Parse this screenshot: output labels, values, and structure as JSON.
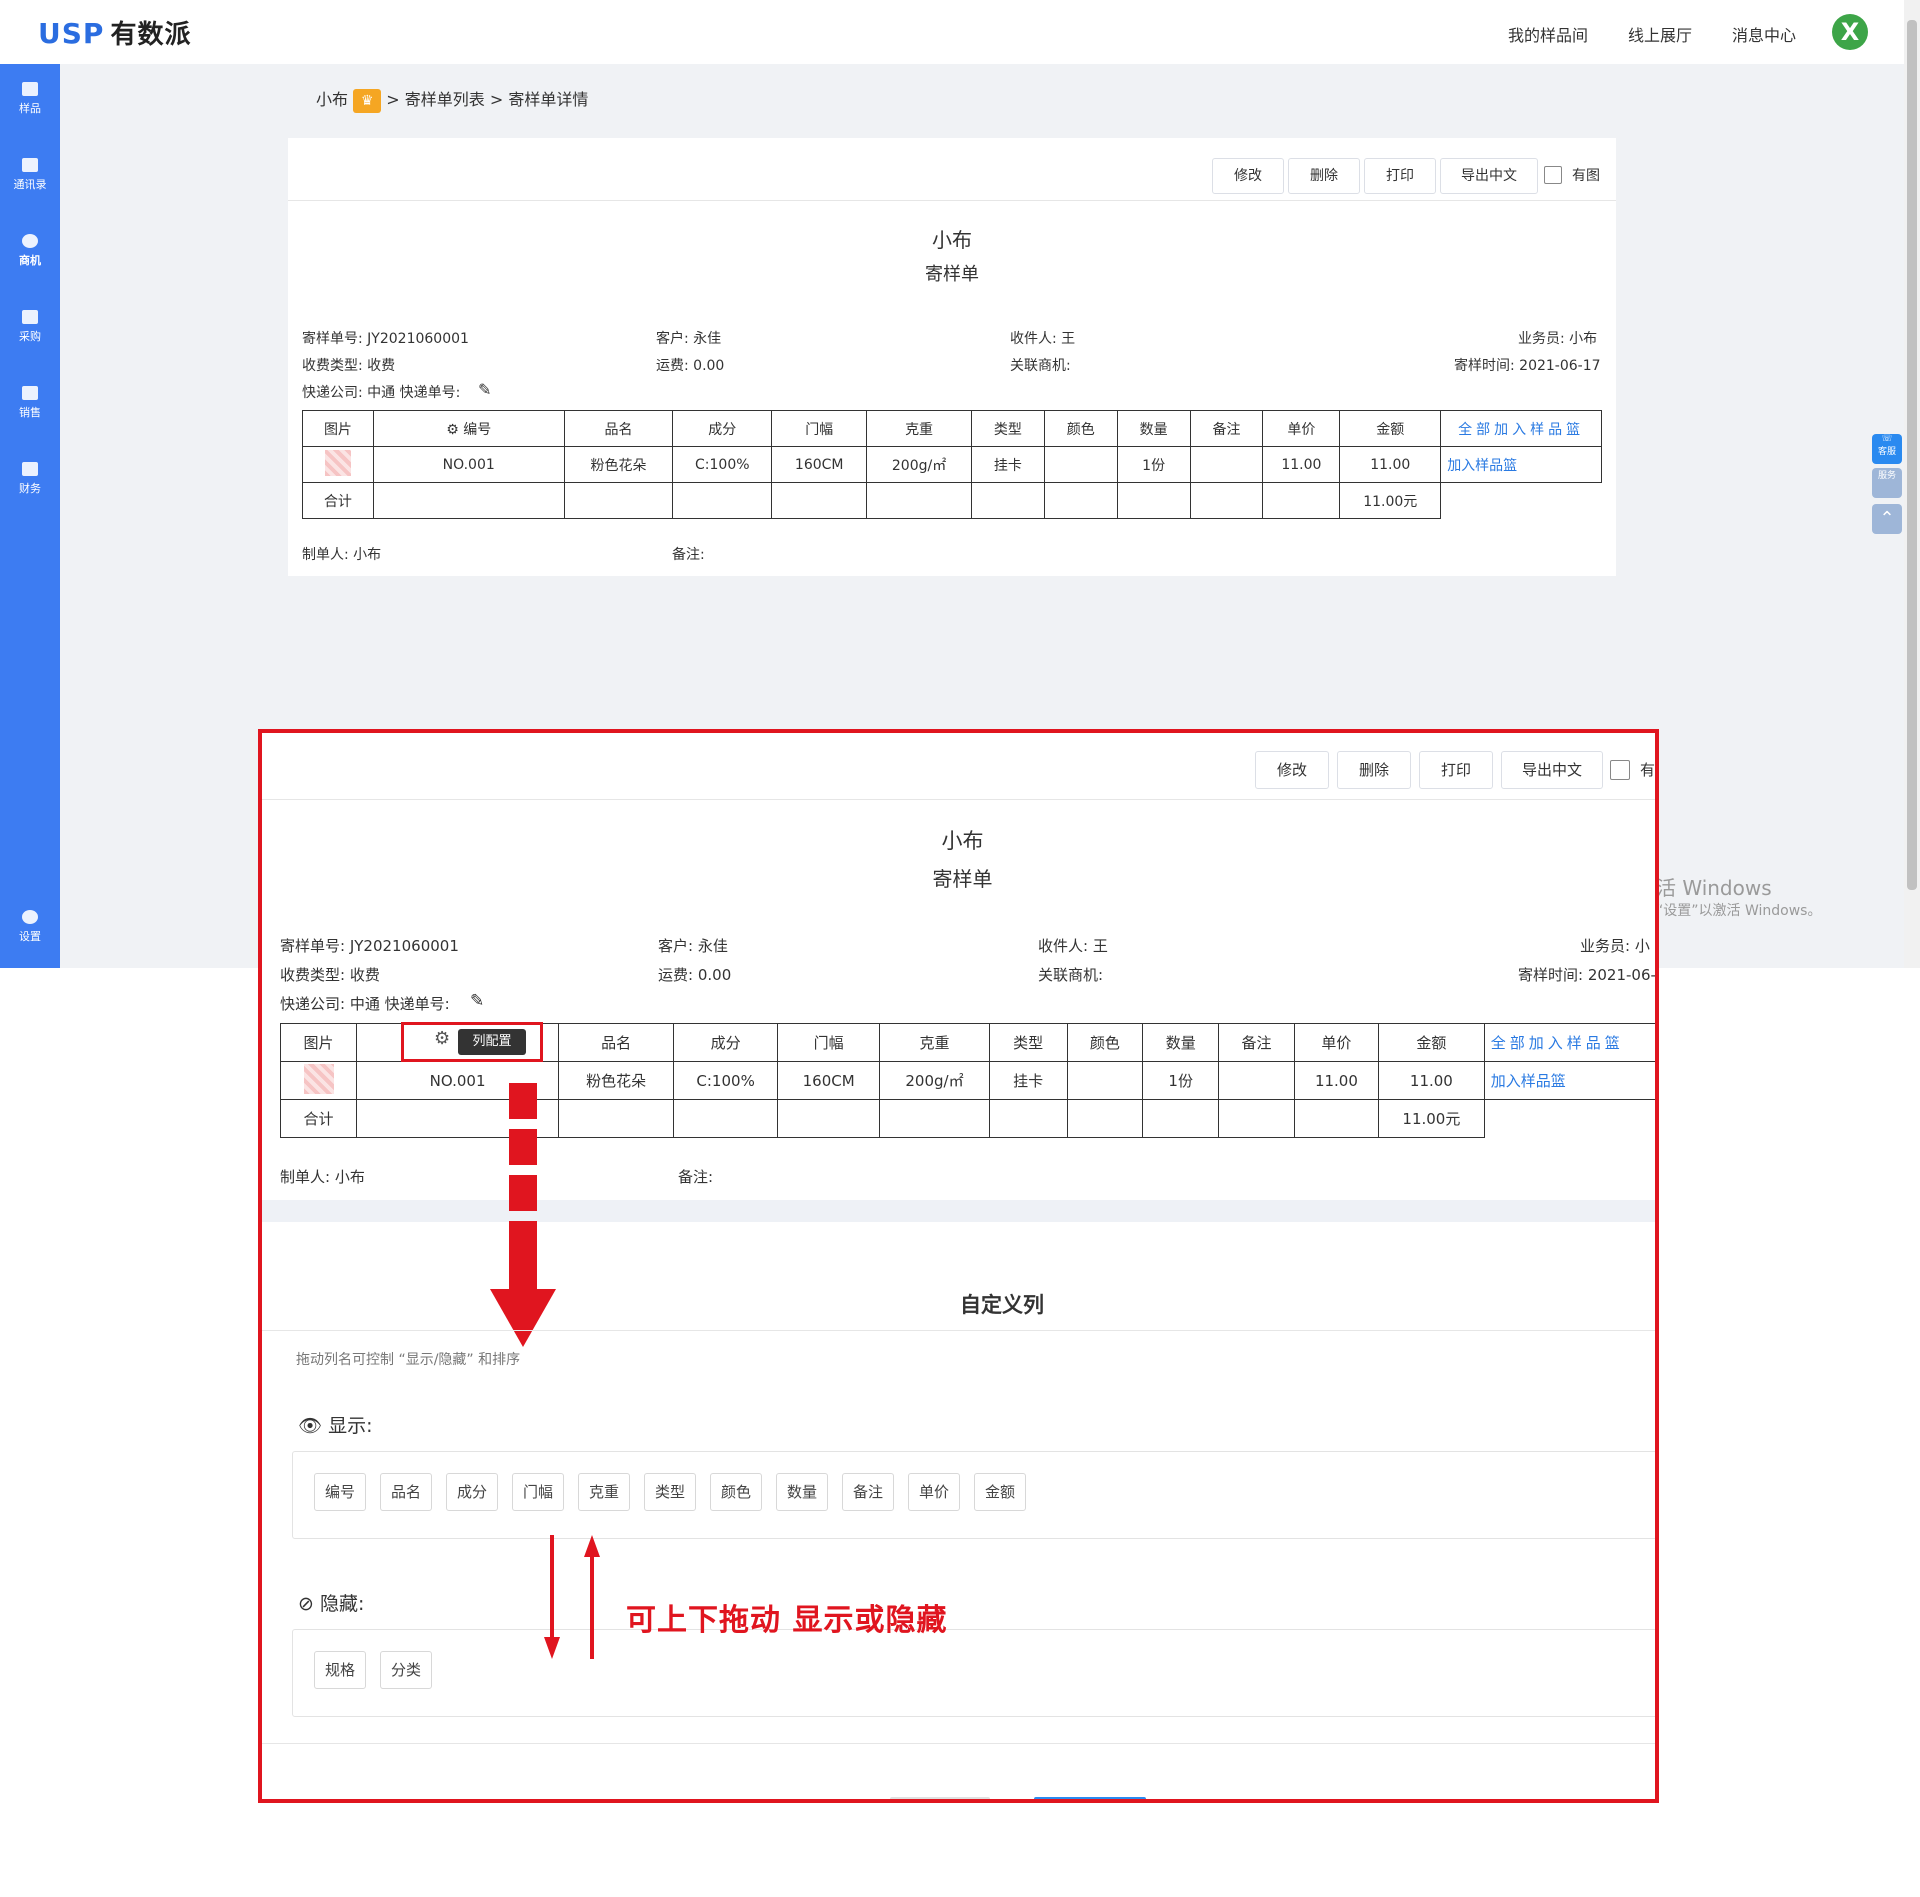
{
  "header": {
    "logo_mark": "USP",
    "logo_text": "有数派",
    "nav": [
      "我的样品间",
      "线上展厅",
      "消息中心"
    ],
    "avatar_letter": "X"
  },
  "sidebar": {
    "items": [
      "样品",
      "通讯录",
      "商机",
      "采购",
      "销售",
      "财务"
    ],
    "settings": "设置"
  },
  "breadcrumb": {
    "root": "小布",
    "sep": ">",
    "list": "寄样单列表",
    "current": "寄样单详情"
  },
  "toolbar": {
    "edit": "修改",
    "delete": "删除",
    "print": "打印",
    "export": "导出中文",
    "has_image": "有图"
  },
  "doc": {
    "company": "小布",
    "doc_type": "寄样单",
    "fields": {
      "order_no_label": "寄样单号:",
      "order_no": "JY2021060001",
      "customer_label": "客户:",
      "customer": "永佳",
      "receiver_label": "收件人:",
      "receiver": "王",
      "salesman_label": "业务员:",
      "salesman": "小布",
      "fee_type_label": "收费类型:",
      "fee_type": "收费",
      "freight_label": "运费:",
      "freight": "0.00",
      "opportunity_label": "关联商机:",
      "send_time_label": "寄样时间:",
      "send_time": "2021-06-17",
      "express_label": "快递公司:",
      "express": "中通",
      "tracking_label": "快递单号:",
      "maker_label": "制单人:",
      "maker": "小布",
      "remark_label": "备注:"
    },
    "table": {
      "headers": [
        "图片",
        "编号",
        "品名",
        "成分",
        "门幅",
        "克重",
        "类型",
        "颜色",
        "数量",
        "备注",
        "单价",
        "金额",
        "全部加入样品篮"
      ],
      "row": [
        "",
        "NO.001",
        "粉色花朵",
        "C:100%",
        "160CM",
        "200g/㎡",
        "挂卡",
        "",
        "1份",
        "",
        "11.00",
        "11.00",
        "加入样品篮"
      ],
      "total_label": "合计",
      "total_value": "11.00元"
    }
  },
  "side_panel": [
    "客服",
    "服务"
  ],
  "watermark": {
    "line1": "活 Windows",
    "line2": "“设置”以激活 Windows。"
  },
  "overlay": {
    "toolbar_has_image": "有",
    "salesman_cut": "小",
    "send_time_cut": "2021-06-",
    "tooltip": "列配置",
    "dialog_title": "自定义列",
    "hint": "拖动列名可控制 “显示/隐藏” 和排序",
    "show_label": "显示:",
    "hide_label": "隐藏:",
    "shown_columns": [
      "编号",
      "品名",
      "成分",
      "门幅",
      "克重",
      "类型",
      "颜色",
      "数量",
      "备注",
      "单价",
      "金额"
    ],
    "hidden_columns": [
      "规格",
      "分类"
    ],
    "annotation": "可上下拖动 显示或隐藏"
  },
  "colors": {
    "brand_blue": "#3d7cf2",
    "annotation_red": "#e0151f",
    "link_blue": "#2a7ae2",
    "crown_orange": "#f5a623"
  }
}
